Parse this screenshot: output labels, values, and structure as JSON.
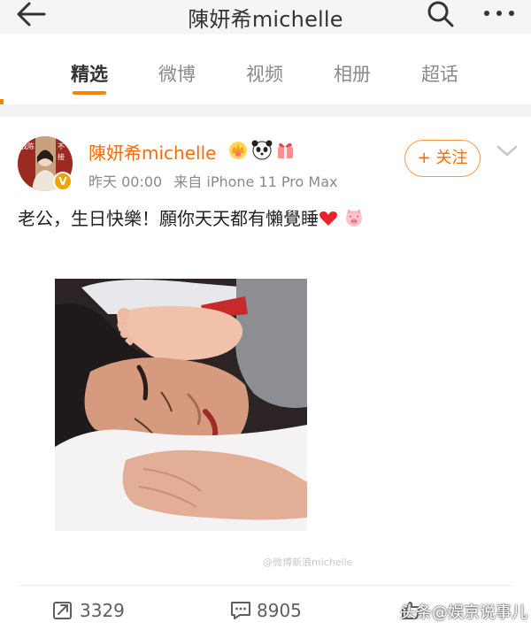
{
  "header": {
    "title": "陳妍希michelle",
    "back_icon": "back-arrow-icon",
    "search_icon": "search-icon",
    "more_icon": "more-dots-icon"
  },
  "tabs": [
    {
      "label": "精选",
      "active": true
    },
    {
      "label": "微博",
      "active": false
    },
    {
      "label": "视频",
      "active": false
    },
    {
      "label": "相册",
      "active": false
    },
    {
      "label": "超话",
      "active": false
    }
  ],
  "post": {
    "username": "陳妍希michelle",
    "time": "昨天 00:00",
    "source": "来自 iPhone 11 Pro Max",
    "follow_label": "+ 关注",
    "text": "老公，生日快樂！願你天天都有懶覺睡",
    "avatar_text": [
      "我",
      "陈",
      "妍",
      "不",
      "可",
      "不",
      "接"
    ],
    "photo_watermark": "@微博新浪michelle"
  },
  "actions": {
    "repost_count": "3329",
    "comment_count": "8905"
  },
  "source_watermark": "头条@娱京说事儿",
  "colors": {
    "accent": "#ff8200",
    "username": "#f86c08",
    "follow_border": "#f79c43"
  }
}
